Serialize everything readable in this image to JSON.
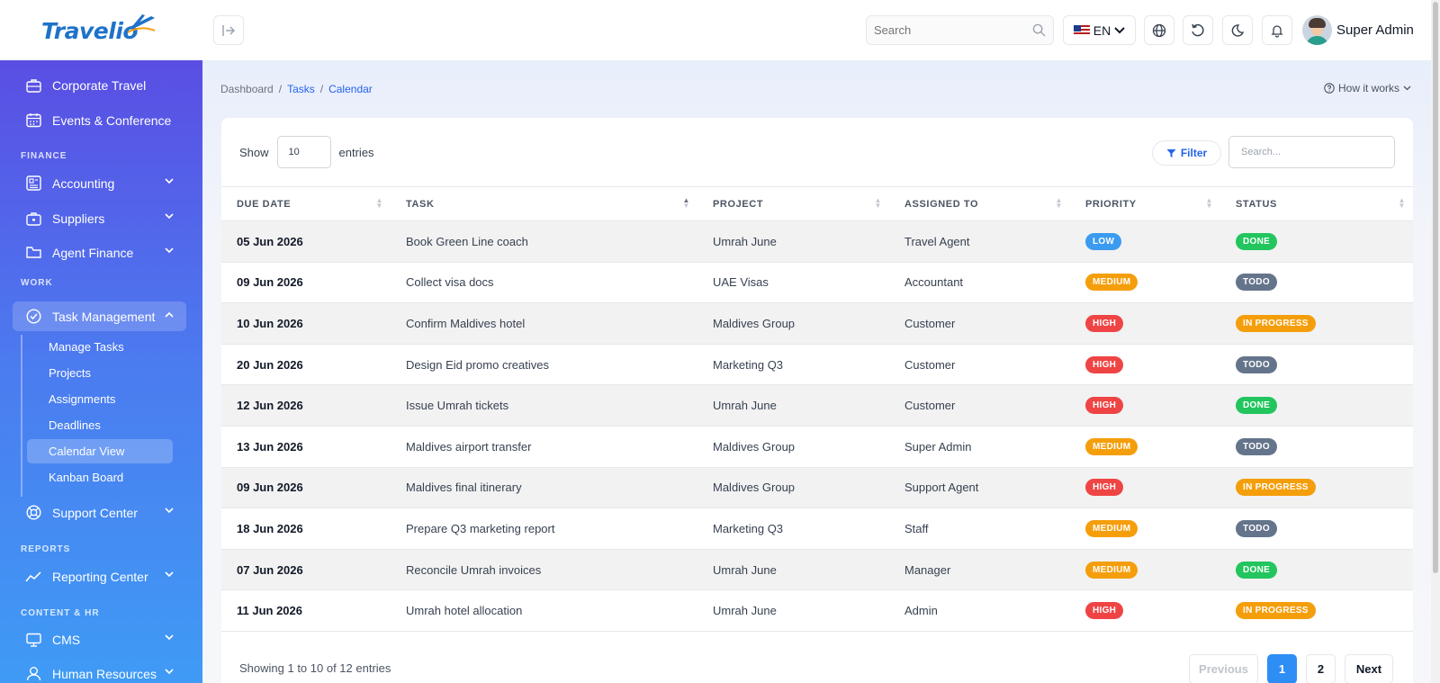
{
  "app": {
    "logo_text": "Travelio",
    "search_placeholder": "Search",
    "language": "EN",
    "user_name": "Super Admin"
  },
  "sidebar": {
    "top_items": [
      {
        "label": "Corporate Travel"
      },
      {
        "label": "Events & Conference"
      }
    ],
    "sections": {
      "finance": "FINANCE",
      "work": "WORK",
      "reports": "REPORTS",
      "content_hr": "CONTENT & HR"
    },
    "finance_items": [
      {
        "label": "Accounting"
      },
      {
        "label": "Suppliers"
      },
      {
        "label": "Agent Finance"
      }
    ],
    "task_management": "Task Management",
    "task_sub": [
      {
        "label": "Manage Tasks"
      },
      {
        "label": "Projects"
      },
      {
        "label": "Assignments"
      },
      {
        "label": "Deadlines"
      },
      {
        "label": "Calendar View"
      },
      {
        "label": "Kanban Board"
      }
    ],
    "support_center": "Support Center",
    "reporting_center": "Reporting Center",
    "cms": "CMS",
    "human_resources": "Human Resources"
  },
  "breadcrumb": {
    "dashboard": "Dashboard",
    "tasks": "Tasks",
    "calendar": "Calendar",
    "sep": "/"
  },
  "how_it_works": "How it works",
  "table_controls": {
    "show_label": "Show",
    "entries_value": "10",
    "entries_label": "entries",
    "filter_label": "Filter",
    "search_placeholder": "Search..."
  },
  "columns": [
    "DUE DATE",
    "TASK",
    "PROJECT",
    "ASSIGNED TO",
    "PRIORITY",
    "STATUS"
  ],
  "rows": [
    {
      "due": "05 Jun 2026",
      "task": "Book Green Line coach",
      "project": "Umrah June",
      "assigned": "Travel Agent",
      "priority": "LOW",
      "status": "DONE"
    },
    {
      "due": "09 Jun 2026",
      "task": "Collect visa docs",
      "project": "UAE Visas",
      "assigned": "Accountant",
      "priority": "MEDIUM",
      "status": "TODO"
    },
    {
      "due": "10 Jun 2026",
      "task": "Confirm Maldives hotel",
      "project": "Maldives Group",
      "assigned": "Customer",
      "priority": "HIGH",
      "status": "IN PROGRESS"
    },
    {
      "due": "20 Jun 2026",
      "task": "Design Eid promo creatives",
      "project": "Marketing Q3",
      "assigned": "Customer",
      "priority": "HIGH",
      "status": "TODO"
    },
    {
      "due": "12 Jun 2026",
      "task": "Issue Umrah tickets",
      "project": "Umrah June",
      "assigned": "Customer",
      "priority": "HIGH",
      "status": "DONE"
    },
    {
      "due": "13 Jun 2026",
      "task": "Maldives airport transfer",
      "project": "Maldives Group",
      "assigned": "Super Admin",
      "priority": "MEDIUM",
      "status": "TODO"
    },
    {
      "due": "09 Jun 2026",
      "task": "Maldives final itinerary",
      "project": "Maldives Group",
      "assigned": "Support Agent",
      "priority": "HIGH",
      "status": "IN PROGRESS"
    },
    {
      "due": "18 Jun 2026",
      "task": "Prepare Q3 marketing report",
      "project": "Marketing Q3",
      "assigned": "Staff",
      "priority": "MEDIUM",
      "status": "TODO"
    },
    {
      "due": "07 Jun 2026",
      "task": "Reconcile Umrah invoices",
      "project": "Umrah June",
      "assigned": "Manager",
      "priority": "MEDIUM",
      "status": "DONE"
    },
    {
      "due": "11 Jun 2026",
      "task": "Umrah hotel allocation",
      "project": "Umrah June",
      "assigned": "Admin",
      "priority": "HIGH",
      "status": "IN PROGRESS"
    }
  ],
  "badge_colors": {
    "LOW": "#3b9bf0",
    "MEDIUM": "#f59e0b",
    "HIGH": "#ef4444",
    "DONE": "#22c55e",
    "TODO": "#64748b",
    "IN PROGRESS": "#f59e0b"
  },
  "footer": {
    "showing": "Showing 1 to 10 of 12 entries",
    "previous": "Previous",
    "page1": "1",
    "page2": "2",
    "next": "Next"
  }
}
